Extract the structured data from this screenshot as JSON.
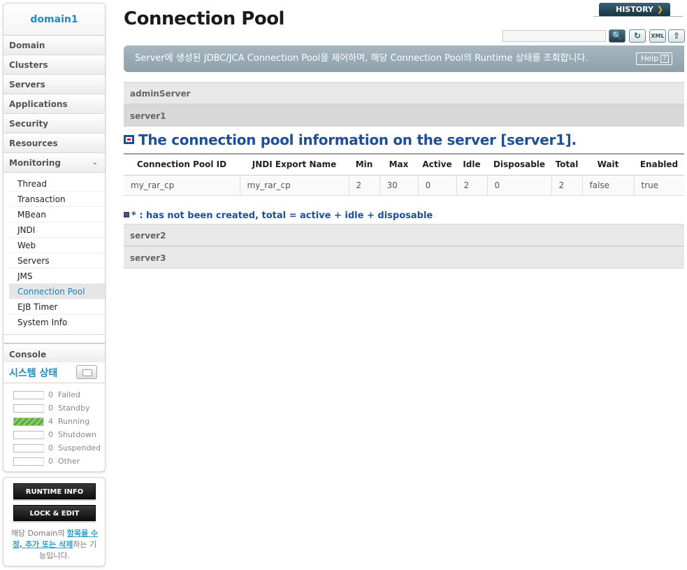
{
  "sidebar": {
    "domain": "domain1",
    "nav": [
      "Domain",
      "Clusters",
      "Servers",
      "Applications",
      "Security",
      "Resources"
    ],
    "monitoring": "Monitoring",
    "submenu": [
      "Thread",
      "Transaction",
      "MBean",
      "JNDI",
      "Web",
      "Servers",
      "JMS",
      "Connection Pool",
      "EJB Timer",
      "System Info"
    ],
    "active_submenu": "Connection Pool",
    "console": "Console",
    "status_title": "시스템 상태",
    "status": [
      {
        "count": "0",
        "label": "Failed",
        "fill": 0
      },
      {
        "count": "0",
        "label": "Standby",
        "fill": 0
      },
      {
        "count": "4",
        "label": "Running",
        "fill": 1
      },
      {
        "count": "0",
        "label": "Shutdown",
        "fill": 0
      },
      {
        "count": "0",
        "label": "Suspended",
        "fill": 0
      },
      {
        "count": "0",
        "label": "Other",
        "fill": 0
      }
    ],
    "runtime_btn": "RUNTIME INFO",
    "lock_btn": "LOCK & EDIT",
    "lock_desc_1": "해당 Domain의 ",
    "lock_desc_hl": "항목을 수정, 추가 또는 삭제",
    "lock_desc_2": "하는 기능입니다."
  },
  "header": {
    "title": "Connection Pool",
    "history": "HISTORY",
    "search_placeholder": "",
    "description": "Server에 생성된 JDBC/JCA Connection Pool을 제어하며, 해당 Connection Pool의 Runtime 상태를 조회합니다.",
    "help": "Help",
    "icons": [
      "search-icon",
      "refresh-icon",
      "xml-icon",
      "export-icon"
    ]
  },
  "servers_top": [
    "adminServer",
    "server1"
  ],
  "section_heading": "The connection pool information on the server [server1].",
  "table": {
    "headers": [
      "Connection Pool ID",
      "JNDI Export Name",
      "Min",
      "Max",
      "Active",
      "Idle",
      "Disposable",
      "Total",
      "Wait",
      "Enabled"
    ],
    "rows": [
      [
        "my_rar_cp",
        "my_rar_cp",
        "2",
        "30",
        "0",
        "2",
        "0",
        "2",
        "false",
        "true"
      ]
    ]
  },
  "legend": "* : has not been created, total = active + idle + disposable",
  "servers_bottom": [
    "server2",
    "server3"
  ],
  "colors": {
    "accent": "#1a8bc4",
    "heading": "#1d4f9a",
    "desc_bar": "#9aabb4",
    "running": "#6cb84a"
  }
}
